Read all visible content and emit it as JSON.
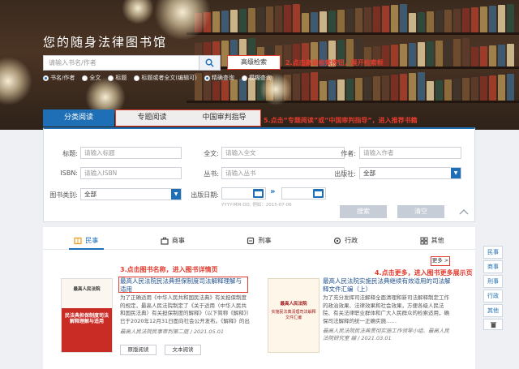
{
  "hero": {
    "watermark": "",
    "title": "您的随身法律图书馆",
    "search_placeholder": "请输入书名/作者",
    "advanced_label": "高级检索",
    "annot_advanced": "2.点击高级检索按钮，展开检索框",
    "radios": [
      {
        "label": "书名/作者",
        "checked": true
      },
      {
        "label": "全文",
        "checked": false
      },
      {
        "label": "标题",
        "checked": false
      },
      {
        "label": "标题或者全文(编辑可)",
        "checked": false
      },
      {
        "label": "精确查询",
        "checked": true
      },
      {
        "label": "模糊查询",
        "checked": false
      }
    ]
  },
  "tabs": {
    "active": "分类阅读",
    "special": "专题阅读",
    "trial": "中国审判指导",
    "annot": "5.点击“专题阅读”或“中国审判指导”，进入推荐书籍"
  },
  "filters": {
    "title_label": "标题:",
    "title_ph": "请输入标题",
    "fulltext_label": "全文:",
    "fulltext_ph": "请输入全文",
    "author_label": "作者:",
    "author_ph": "请输入作者",
    "isbn_label": "ISBN:",
    "isbn_ph": "请输入ISBN",
    "series_label": "丛书:",
    "series_ph": "请输入丛书",
    "publisher_label": "出版社:",
    "publisher_value": "全部",
    "category_label": "图书类别:",
    "category_value": "全部",
    "date_label": "出版日期:",
    "date_hint_1": "YYYY-MM-DD,",
    "date_hint_2": "例如：2015-07-06",
    "search_btn": "搜索",
    "clear_btn": "清空"
  },
  "categories": [
    "民事",
    "商事",
    "刑事",
    "行政",
    "其他"
  ],
  "more_label": "更多 >",
  "annot_title": "3.点击图书名称，进入图书详情页",
  "annot_more": "4.点击更多，进入图书更多展示页",
  "books": [
    {
      "cover_top": "最高人民法院",
      "cover_main": "民法典担保制度司法解释理解与适用",
      "title": "最高人民法院民法典担保制度司法解释理解与适用",
      "desc": "为了正确适用《中华人民共和国民法典》有关担保制度的规定，最高人民法院制定了《关于适用〈中华人民共和国民法典〉有关担保制度的解释》（以下简称《解释》）已于2020年12月31日面向社会公开发布。《解释》的出台，意为更好地服务……",
      "meta": "最高人民法院民事审判第二庭 / 2021.05.01",
      "btn1": "原版阅读",
      "btn2": "文本阅读"
    },
    {
      "cover_top": "最高人民法院",
      "cover_main": "实施民法典清理司法解释文件汇编",
      "title": "最高人民法院实施民法典继续有效适用的司法解释文件汇编（上）",
      "desc": "为了充分发挥司法解释全面清理和新司法解释制定工作的政治效果、法律效果和社会效果，方便各级人民法院、有关法律职业群体和广大人民群众的检索适用，确保司法解释的统一正确实施……",
      "meta": "最高人民法院民法典贯彻实施工作领导小组、最高人民法院研究室 编 / 2021.03.01",
      "btn1": "原版阅读",
      "btn2": "文本阅读"
    }
  ],
  "sidenav": [
    "民事",
    "商事",
    "刑事",
    "行政",
    "其他"
  ]
}
